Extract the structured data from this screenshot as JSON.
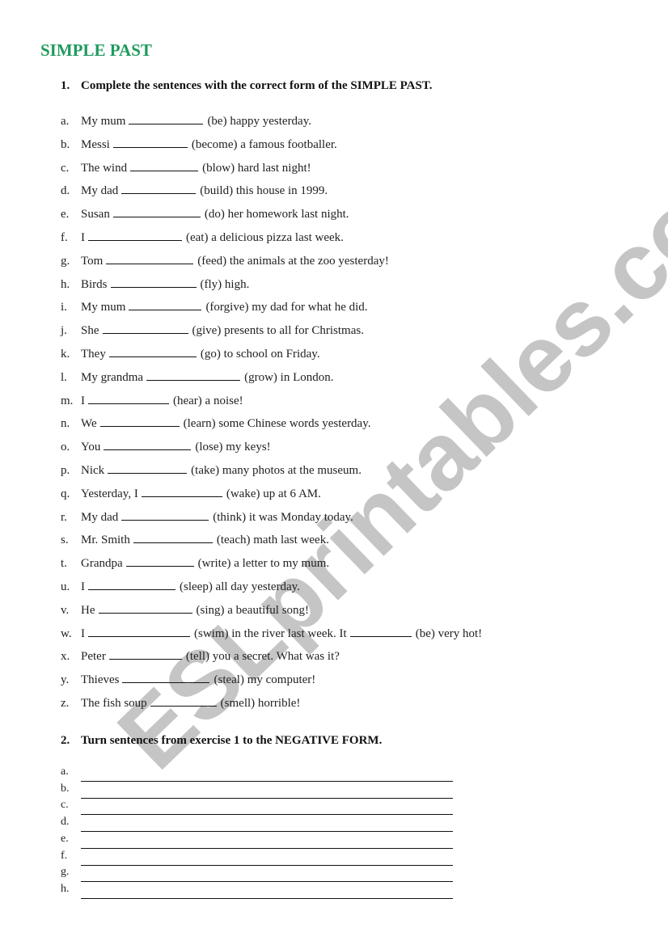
{
  "title": "SIMPLE PAST",
  "exercise1": {
    "number": "1.",
    "instruction": "Complete the sentences with the correct form of the SIMPLE PAST.",
    "items": [
      {
        "letter": "a.",
        "before": "My mum",
        "blank": 92,
        "after": "(be) happy yesterday."
      },
      {
        "letter": "b.",
        "before": "Messi",
        "blank": 92,
        "after": "(become) a famous footballer."
      },
      {
        "letter": "c.",
        "before": "The wind",
        "blank": 84,
        "after": "(blow) hard last night!"
      },
      {
        "letter": "d.",
        "before": "My dad",
        "blank": 92,
        "after": "(build) this house in 1999."
      },
      {
        "letter": "e.",
        "before": "Susan",
        "blank": 108,
        "after": "(do) her homework last night."
      },
      {
        "letter": "f.",
        "before": "I",
        "blank": 116,
        "after": "(eat) a delicious pizza last week."
      },
      {
        "letter": "g.",
        "before": "Tom",
        "blank": 108,
        "after": "(feed) the animals at the zoo yesterday!"
      },
      {
        "letter": "h.",
        "before": "Birds",
        "blank": 106,
        "after": "(fly) high."
      },
      {
        "letter": "i.",
        "before": "My mum",
        "blank": 90,
        "after": "(forgive) my dad for what he did."
      },
      {
        "letter": "j.",
        "before": "She",
        "blank": 106,
        "after": "(give) presents to all for Christmas."
      },
      {
        "letter": "k.",
        "before": "They",
        "blank": 108,
        "after": "(go) to school on Friday."
      },
      {
        "letter": "l.",
        "before": "My grandma",
        "blank": 116,
        "after": "(grow) in London."
      },
      {
        "letter": "m.",
        "before": "I",
        "blank": 100,
        "after": "(hear) a noise!"
      },
      {
        "letter": "n.",
        "before": "We",
        "blank": 98,
        "after": "(learn) some Chinese words yesterday."
      },
      {
        "letter": "o.",
        "before": "You",
        "blank": 108,
        "after": "(lose) my keys!"
      },
      {
        "letter": "p.",
        "before": "Nick",
        "blank": 98,
        "after": "(take) many photos at the museum."
      },
      {
        "letter": "q.",
        "before": "Yesterday, I",
        "blank": 100,
        "after": "(wake) up at 6 AM."
      },
      {
        "letter": "r.",
        "before": "My dad",
        "blank": 108,
        "after": "(think) it was Monday today."
      },
      {
        "letter": "s.",
        "before": "Mr. Smith",
        "blank": 98,
        "after": "(teach) math last week."
      },
      {
        "letter": "t.",
        "before": "Grandpa",
        "blank": 84,
        "after": "(write) a letter to my mum."
      },
      {
        "letter": "u.",
        "before": "I",
        "blank": 108,
        "after": "(sleep) all day yesterday."
      },
      {
        "letter": "v.",
        "before": "He",
        "blank": 116,
        "after": "(sing) a beautiful song!"
      },
      {
        "letter": "w.",
        "before": "I",
        "blank": 126,
        "after": "(swim) in the river last week. It",
        "blank2": 76,
        "after2": "(be) very hot!"
      },
      {
        "letter": "x.",
        "before": "Peter",
        "blank": 90,
        "after": "(tell) you a secret. What was it?"
      },
      {
        "letter": "y.",
        "before": "Thieves",
        "blank": 108,
        "after": "(steal) my computer!"
      },
      {
        "letter": "z.",
        "before": "The fish soup",
        "blank": 82,
        "after": "(smell) horrible!"
      }
    ]
  },
  "exercise2": {
    "number": "2.",
    "instruction": "Turn sentences from exercise 1 to the NEGATIVE FORM.",
    "items": [
      "a.",
      "b.",
      "c.",
      "d.",
      "e.",
      "f.",
      "g.",
      "h."
    ]
  },
  "watermark": "ESLprintables.com",
  "colors": {
    "title": "#1f9a5e",
    "text": "#111111",
    "watermark": "#969696"
  }
}
